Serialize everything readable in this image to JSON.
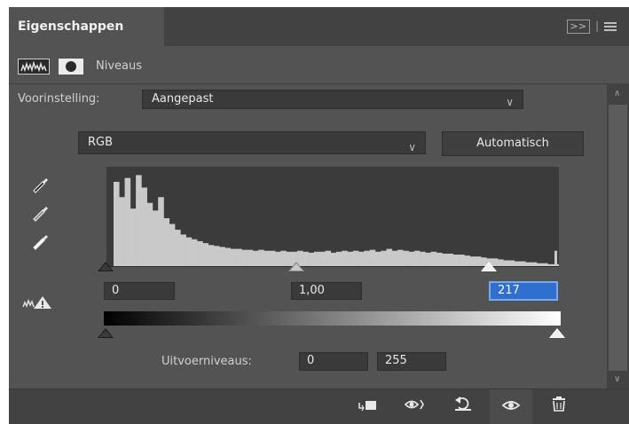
{
  "panel": {
    "tab_title": "Eigenschappen",
    "collapse_glyph": ">>",
    "adjustment_type": "Niveaus"
  },
  "preset": {
    "label": "Voorinstelling:",
    "value": "Aangepast"
  },
  "channel": {
    "value": "RGB",
    "auto_button": "Automatisch"
  },
  "input_levels": {
    "shadow": "0",
    "midtone": "1,00",
    "highlight": "217"
  },
  "output_levels": {
    "label": "Uitvoerniveaus:",
    "low": "0",
    "high": "255"
  },
  "icons": {
    "eyedroppers": [
      "shadow-eyedropper-icon",
      "midtone-eyedropper-icon",
      "highlight-eyedropper-icon"
    ],
    "bottom": [
      "clip-to-layer-icon",
      "view-previous-state-icon",
      "reset-icon",
      "visibility-eye-icon",
      "trash-icon"
    ]
  },
  "histogram": {
    "bins": [
      0.88,
      0.72,
      0.92,
      0.6,
      0.95,
      0.82,
      0.66,
      0.58,
      0.72,
      0.5,
      0.44,
      0.38,
      0.33,
      0.3,
      0.28,
      0.26,
      0.24,
      0.22,
      0.21,
      0.2,
      0.19,
      0.18,
      0.18,
      0.17,
      0.17,
      0.16,
      0.17,
      0.16,
      0.16,
      0.15,
      0.16,
      0.15,
      0.15,
      0.16,
      0.15,
      0.14,
      0.15,
      0.15,
      0.16,
      0.14,
      0.15,
      0.16,
      0.15,
      0.16,
      0.15,
      0.16,
      0.17,
      0.15,
      0.16,
      0.18,
      0.16,
      0.17,
      0.16,
      0.15,
      0.16,
      0.15,
      0.14,
      0.15,
      0.14,
      0.13,
      0.13,
      0.12,
      0.12,
      0.11,
      0.1,
      0.1,
      0.09,
      0.08,
      0.08,
      0.07,
      0.06,
      0.06,
      0.05,
      0.05,
      0.04,
      0.04,
      0.03,
      0.03,
      0.02,
      0.02
    ]
  }
}
